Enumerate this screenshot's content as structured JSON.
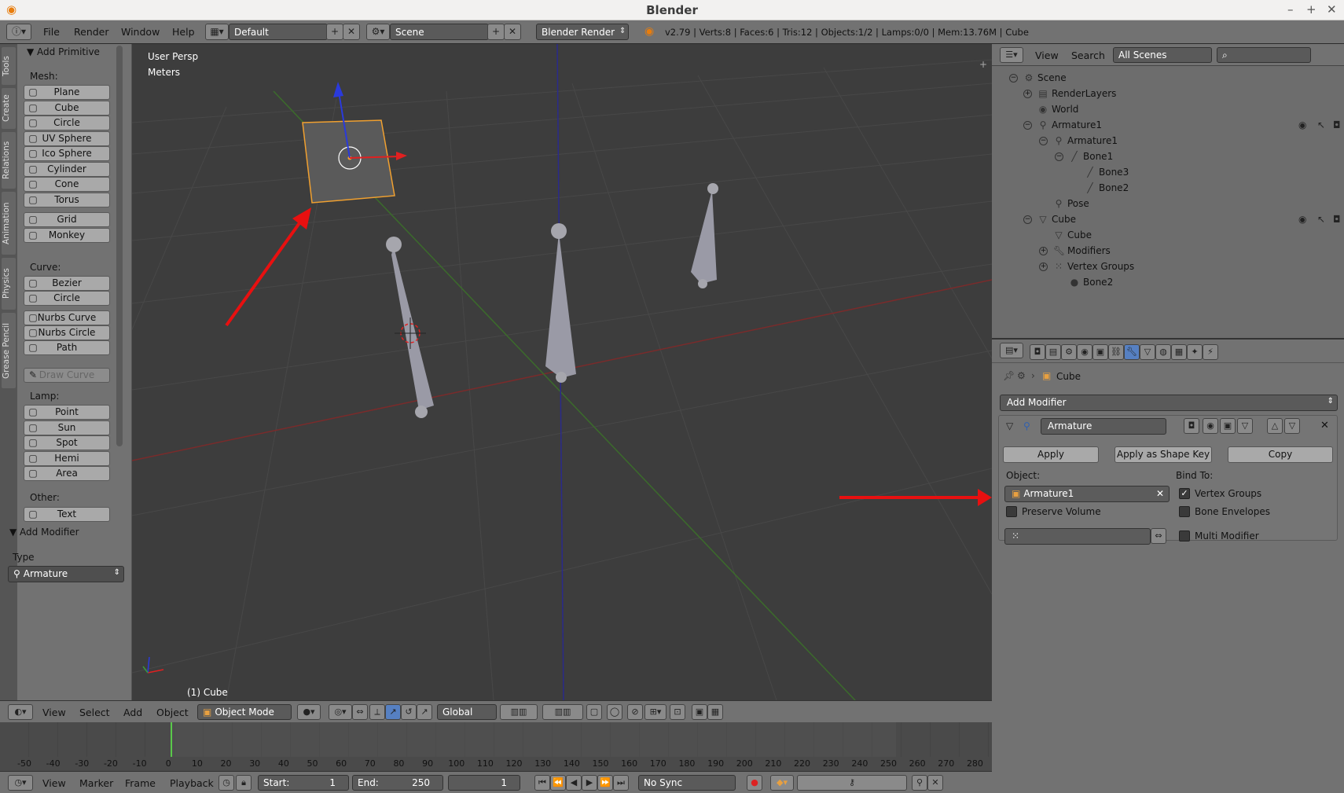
{
  "window": {
    "title": "Blender"
  },
  "topbar": {
    "menus": [
      "File",
      "Render",
      "Window",
      "Help"
    ],
    "layout": "Default",
    "scene": "Scene",
    "engine": "Blender Render",
    "stats": "v2.79 | Verts:8 | Faces:6 | Tris:12 | Objects:1/2 | Lamps:0/0 | Mem:13.76M | Cube"
  },
  "side_tabs": [
    "Tools",
    "Create",
    "Relations",
    "Animation",
    "Physics",
    "Grease Pencil"
  ],
  "toolshelf": {
    "panel_title": "Add Primitive",
    "mesh_label": "Mesh:",
    "mesh_items": [
      {
        "label": "Plane",
        "icon": "plane-icon"
      },
      {
        "label": "Cube",
        "icon": "cube-icon"
      },
      {
        "label": "Circle",
        "icon": "circle-icon"
      },
      {
        "label": "UV Sphere",
        "icon": "uv-sphere-icon"
      },
      {
        "label": "Ico Sphere",
        "icon": "ico-sphere-icon"
      },
      {
        "label": "Cylinder",
        "icon": "cylinder-icon"
      },
      {
        "label": "Cone",
        "icon": "cone-icon"
      },
      {
        "label": "Torus",
        "icon": "torus-icon"
      },
      {
        "label": "Grid",
        "icon": "grid-icon"
      },
      {
        "label": "Monkey",
        "icon": "monkey-icon"
      }
    ],
    "curve_label": "Curve:",
    "curve_items": [
      {
        "label": "Bezier",
        "icon": "bezier-icon"
      },
      {
        "label": "Circle",
        "icon": "curve-circle-icon"
      },
      {
        "label": "Nurbs Curve",
        "icon": "nurbs-curve-icon"
      },
      {
        "label": "Nurbs Circle",
        "icon": "nurbs-circle-icon"
      },
      {
        "label": "Path",
        "icon": "path-icon"
      }
    ],
    "draw_curve": "Draw Curve",
    "lamp_label": "Lamp:",
    "lamp_items": [
      {
        "label": "Point",
        "icon": "point-lamp-icon"
      },
      {
        "label": "Sun",
        "icon": "sun-lamp-icon"
      },
      {
        "label": "Spot",
        "icon": "spot-lamp-icon"
      },
      {
        "label": "Hemi",
        "icon": "hemi-lamp-icon"
      },
      {
        "label": "Area",
        "icon": "area-lamp-icon"
      }
    ],
    "other_label": "Other:",
    "other_items": [
      {
        "label": "Text",
        "icon": "text-icon"
      }
    ],
    "add_modifier_title": "Add Modifier",
    "type_label": "Type",
    "type_value": "Armature"
  },
  "viewport": {
    "view_name": "User Persp",
    "units": "Meters",
    "active_object": "(1) Cube"
  },
  "view_header": {
    "menus": [
      "View",
      "Select",
      "Add",
      "Object"
    ],
    "mode": "Object Mode",
    "orientation": "Global"
  },
  "timeline": {
    "ticks": [
      "-50",
      "-40",
      "-30",
      "-20",
      "-10",
      "0",
      "10",
      "20",
      "30",
      "40",
      "50",
      "60",
      "70",
      "80",
      "90",
      "100",
      "110",
      "120",
      "130",
      "140",
      "150",
      "160",
      "170",
      "180",
      "190",
      "200",
      "210",
      "220",
      "230",
      "240",
      "250",
      "260",
      "270",
      "280"
    ],
    "menus": [
      "View",
      "Marker",
      "Frame",
      "Playback"
    ],
    "start_label": "Start:",
    "start": "1",
    "end_label": "End:",
    "end": "250",
    "current": "1",
    "sync": "No Sync"
  },
  "outliner": {
    "menus": [
      "View",
      "Search"
    ],
    "filter": "All Scenes",
    "tree": [
      {
        "label": "Scene",
        "icon": "scene-icon"
      },
      {
        "label": "RenderLayers",
        "icon": "render-layers-icon"
      },
      {
        "label": "World",
        "icon": "world-icon"
      },
      {
        "label": "Armature1",
        "icon": "armature-object-icon"
      },
      {
        "label": "Armature1",
        "icon": "armature-data-icon"
      },
      {
        "label": "Bone1",
        "icon": "bone-icon"
      },
      {
        "label": "Bone3",
        "icon": "bone-icon"
      },
      {
        "label": "Bone2",
        "icon": "bone-icon"
      },
      {
        "label": "Pose",
        "icon": "pose-icon"
      },
      {
        "label": "Cube",
        "icon": "mesh-object-icon"
      },
      {
        "label": "Cube",
        "icon": "mesh-data-icon"
      },
      {
        "label": "Modifiers",
        "icon": "wrench-icon"
      },
      {
        "label": "Vertex Groups",
        "icon": "vertex-groups-icon"
      },
      {
        "label": "Bone2",
        "icon": "vertex-group-icon"
      }
    ]
  },
  "properties": {
    "context": "Cube",
    "add_modifier": "Add Modifier",
    "modifier_name": "Armature",
    "apply": "Apply",
    "apply_shape_key": "Apply as Shape Key",
    "copy": "Copy",
    "object_label": "Object:",
    "object_value": "Armature1",
    "bind_to_label": "Bind To:",
    "preserve_volume": {
      "label": "Preserve Volume",
      "checked": false
    },
    "vertex_groups": {
      "label": "Vertex Groups",
      "checked": true
    },
    "bone_envelopes": {
      "label": "Bone Envelopes",
      "checked": false
    },
    "multi_modifier": {
      "label": "Multi Modifier",
      "checked": false
    }
  },
  "colors": {
    "annotation_arrow": "#e81010",
    "selection": "#f0a030"
  }
}
